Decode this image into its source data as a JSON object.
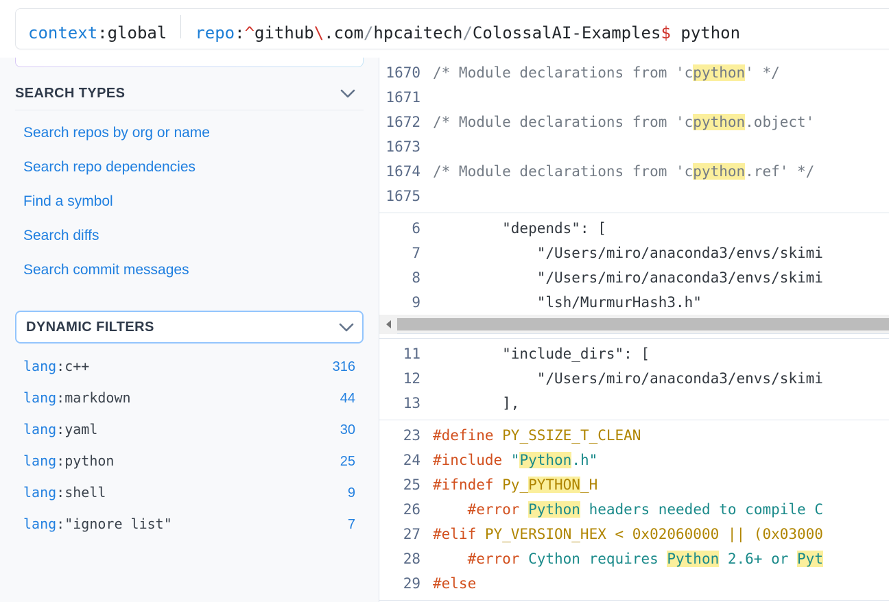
{
  "search": {
    "name": "search-query-input",
    "tokens": [
      {
        "kind": "filter",
        "text": "context"
      },
      {
        "kind": "plain",
        "text": ":"
      },
      {
        "kind": "plain",
        "text": "global"
      },
      {
        "kind": "sep",
        "text": ""
      },
      {
        "kind": "filter",
        "text": "repo"
      },
      {
        "kind": "plain",
        "text": ":"
      },
      {
        "kind": "meta",
        "text": "^"
      },
      {
        "kind": "plain",
        "text": "github"
      },
      {
        "kind": "meta",
        "text": "\\"
      },
      {
        "kind": "plain",
        "text": ".com"
      },
      {
        "kind": "slash",
        "text": "/"
      },
      {
        "kind": "plain",
        "text": "hpcaitech"
      },
      {
        "kind": "slash",
        "text": "/"
      },
      {
        "kind": "plain",
        "text": "ColossalAI-Examples"
      },
      {
        "kind": "meta",
        "text": "$"
      },
      {
        "kind": "plain",
        "text": " python"
      }
    ],
    "full_query": "context:global repo:^github\\.com/hpcaitech/ColossalAI-Examples$ python"
  },
  "sidebar": {
    "search_types": {
      "title": "SEARCH TYPES",
      "chevron": "chevron-down-icon",
      "items": [
        {
          "label": "Search repos by org or name"
        },
        {
          "label": "Search repo dependencies"
        },
        {
          "label": "Find a symbol"
        },
        {
          "label": "Search diffs"
        },
        {
          "label": "Search commit messages"
        }
      ]
    },
    "dynamic_filters": {
      "title": "DYNAMIC FILTERS",
      "chevron": "chevron-down-icon",
      "facets": [
        {
          "key": "lang",
          "value": "c++",
          "count": "316"
        },
        {
          "key": "lang",
          "value": "markdown",
          "count": "44"
        },
        {
          "key": "lang",
          "value": "yaml",
          "count": "30"
        },
        {
          "key": "lang",
          "value": "python",
          "count": "25"
        },
        {
          "key": "lang",
          "value": "shell",
          "count": "9"
        },
        {
          "key": "lang",
          "value": "\"ignore list\"",
          "count": "7"
        }
      ]
    }
  },
  "results": {
    "blocks": [
      {
        "name": "code-result-cpython-decls",
        "lines": [
          {
            "num": "1670",
            "parts": [
              {
                "t": "/* Module declarations from 'c",
                "c": "cmt"
              },
              {
                "t": "python",
                "c": "cmt",
                "hl": true
              },
              {
                "t": "' */",
                "c": "cmt"
              }
            ]
          },
          {
            "num": "1671",
            "parts": []
          },
          {
            "num": "1672",
            "parts": [
              {
                "t": "/* Module declarations from 'c",
                "c": "cmt"
              },
              {
                "t": "python",
                "c": "cmt",
                "hl": true
              },
              {
                "t": ".object'",
                "c": "cmt"
              }
            ]
          },
          {
            "num": "1673",
            "parts": []
          },
          {
            "num": "1674",
            "parts": [
              {
                "t": "/* Module declarations from 'c",
                "c": "cmt"
              },
              {
                "t": "python",
                "c": "cmt",
                "hl": true
              },
              {
                "t": ".ref' */",
                "c": "cmt"
              }
            ]
          },
          {
            "num": "1675",
            "parts": []
          }
        ]
      },
      {
        "name": "code-result-depends",
        "lines": [
          {
            "num": "6",
            "parts": [
              {
                "t": "        \"depends\": [",
                "c": "str"
              }
            ]
          },
          {
            "num": "7",
            "parts": [
              {
                "t": "            \"/Users/miro/anaconda3/envs/skimi",
                "c": "str"
              }
            ]
          },
          {
            "num": "8",
            "parts": [
              {
                "t": "            \"/Users/miro/anaconda3/envs/skimi",
                "c": "str"
              }
            ]
          },
          {
            "num": "9",
            "parts": [
              {
                "t": "            \"lsh/MurmurHash3.h\"",
                "c": "str"
              }
            ]
          }
        ],
        "scrollbar": {
          "name": "horizontal-scrollbar",
          "arrow": "scroll-left-arrow-icon"
        }
      },
      {
        "name": "code-result-include-dirs",
        "lines": [
          {
            "num": "11",
            "parts": [
              {
                "t": "        \"include_dirs\": [",
                "c": "str"
              }
            ]
          },
          {
            "num": "12",
            "parts": [
              {
                "t": "            \"/Users/miro/anaconda3/envs/skimi",
                "c": "str"
              }
            ]
          },
          {
            "num": "13",
            "parts": [
              {
                "t": "        ],",
                "c": "str"
              }
            ]
          }
        ]
      },
      {
        "name": "code-result-python-h",
        "lines": [
          {
            "num": "23",
            "parts": [
              {
                "t": "#define",
                "c": "pre"
              },
              {
                "t": " PY_SSIZE_T_CLEAN",
                "c": "mac"
              }
            ]
          },
          {
            "num": "24",
            "parts": [
              {
                "t": "#include",
                "c": "pre"
              },
              {
                "t": " \"",
                "c": "tealtxt"
              },
              {
                "t": "Python",
                "c": "tealtxt",
                "hl": true
              },
              {
                "t": ".h\"",
                "c": "tealtxt"
              }
            ]
          },
          {
            "num": "25",
            "parts": [
              {
                "t": "#ifndef",
                "c": "pre"
              },
              {
                "t": " Py_",
                "c": "mac"
              },
              {
                "t": "PYTHON",
                "c": "mac",
                "hl": true
              },
              {
                "t": "_H",
                "c": "mac"
              }
            ]
          },
          {
            "num": "26",
            "parts": [
              {
                "t": "    ",
                "c": "str"
              },
              {
                "t": "#error",
                "c": "pre"
              },
              {
                "t": " ",
                "c": "tealtxt"
              },
              {
                "t": "Python",
                "c": "tealtxt",
                "hl": true
              },
              {
                "t": " headers needed to compile C",
                "c": "tealtxt"
              }
            ]
          },
          {
            "num": "27",
            "parts": [
              {
                "t": "#elif",
                "c": "pre"
              },
              {
                "t": " PY_VERSION_HEX < 0x02060000 || (0x03000",
                "c": "mac"
              }
            ]
          },
          {
            "num": "28",
            "parts": [
              {
                "t": "    ",
                "c": "str"
              },
              {
                "t": "#error",
                "c": "pre"
              },
              {
                "t": " Cython requires ",
                "c": "tealtxt"
              },
              {
                "t": "Python",
                "c": "tealtxt",
                "hl": true
              },
              {
                "t": " 2.6+ or ",
                "c": "tealtxt"
              },
              {
                "t": "Pyt",
                "c": "tealtxt",
                "hl": true
              }
            ]
          },
          {
            "num": "29",
            "parts": [
              {
                "t": "#else",
                "c": "pre"
              }
            ]
          }
        ]
      }
    ]
  },
  "colors": {
    "link_blue": "#1f7fe0",
    "keyword_blue": "#1971e8",
    "meta_red": "#d0342c",
    "highlight_yellow": "#fbef9c",
    "focus_border_blue": "#93c5fd",
    "line_number": "#5a6b88",
    "preproc_orange": "#d2501e",
    "macro_gold": "#b08500",
    "teal_string": "#1a8a8a",
    "comment_gray": "#737b85"
  }
}
